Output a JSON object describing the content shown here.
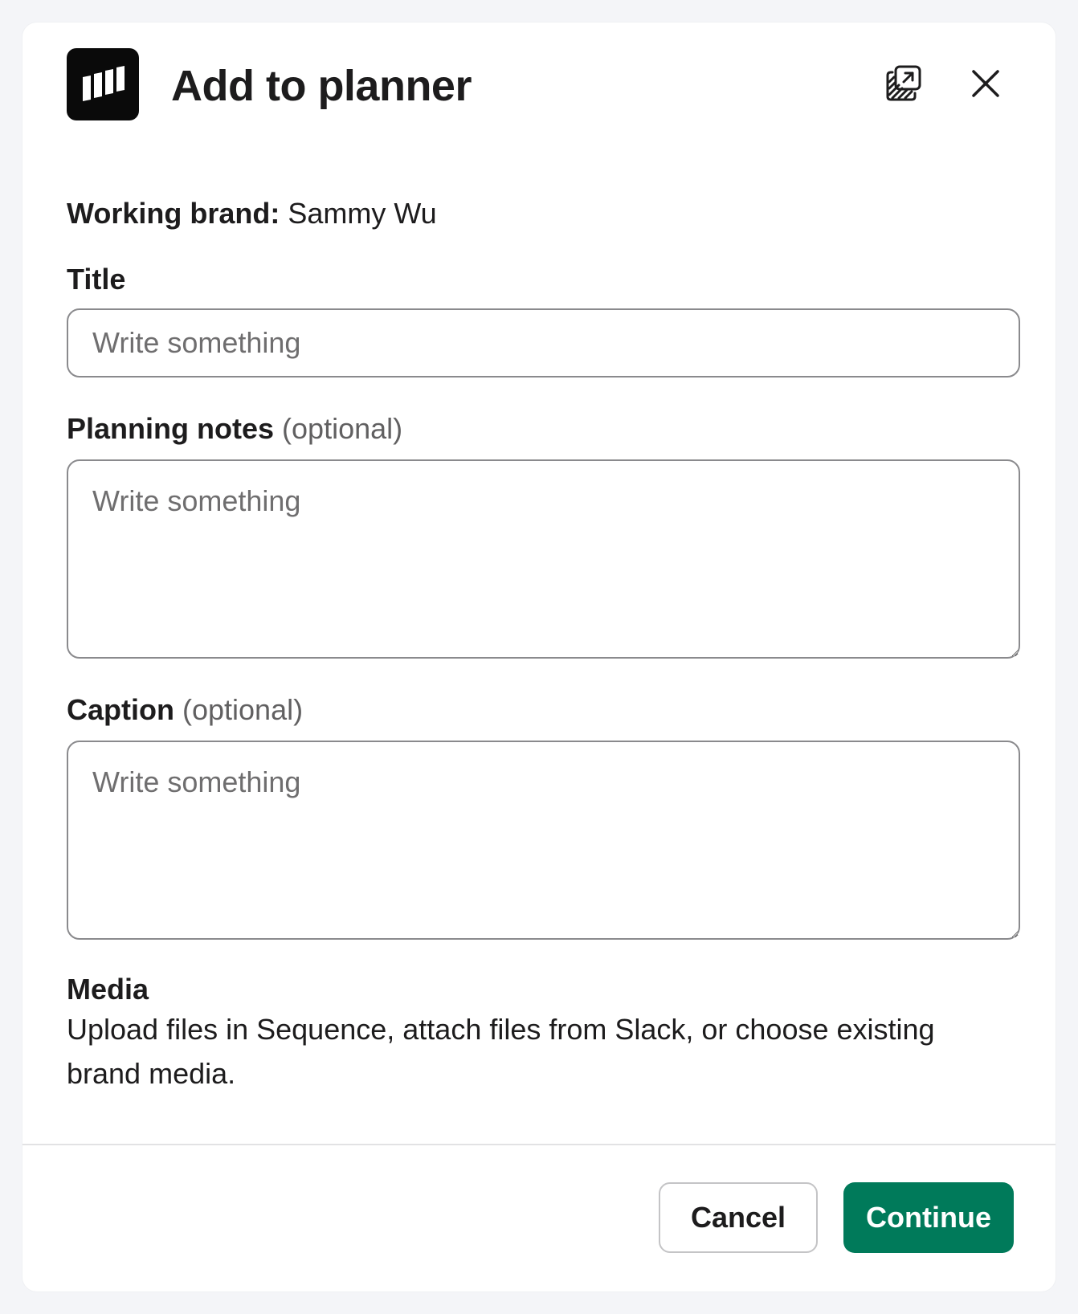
{
  "modal": {
    "title": "Add to planner",
    "logo_icon": "sequence-bars-logo-icon",
    "popout_icon": "popout-window-icon",
    "close_icon": "close-icon"
  },
  "working_brand": {
    "label": "Working brand:",
    "value": "Sammy Wu"
  },
  "fields": {
    "title": {
      "label": "Title",
      "placeholder": "Write something",
      "value": ""
    },
    "planning_notes": {
      "label": "Planning notes",
      "optional": "(optional)",
      "placeholder": "Write something",
      "value": ""
    },
    "caption": {
      "label": "Caption",
      "optional": "(optional)",
      "placeholder": "Write something",
      "value": ""
    }
  },
  "media": {
    "title": "Media",
    "description": "Upload files in Sequence, attach files from Slack, or choose existing brand media."
  },
  "footer": {
    "cancel_label": "Cancel",
    "continue_label": "Continue"
  },
  "colors": {
    "primary": "#007a5a",
    "background": "#f4f5f8",
    "text": "#1d1c1d",
    "muted": "#616061"
  }
}
